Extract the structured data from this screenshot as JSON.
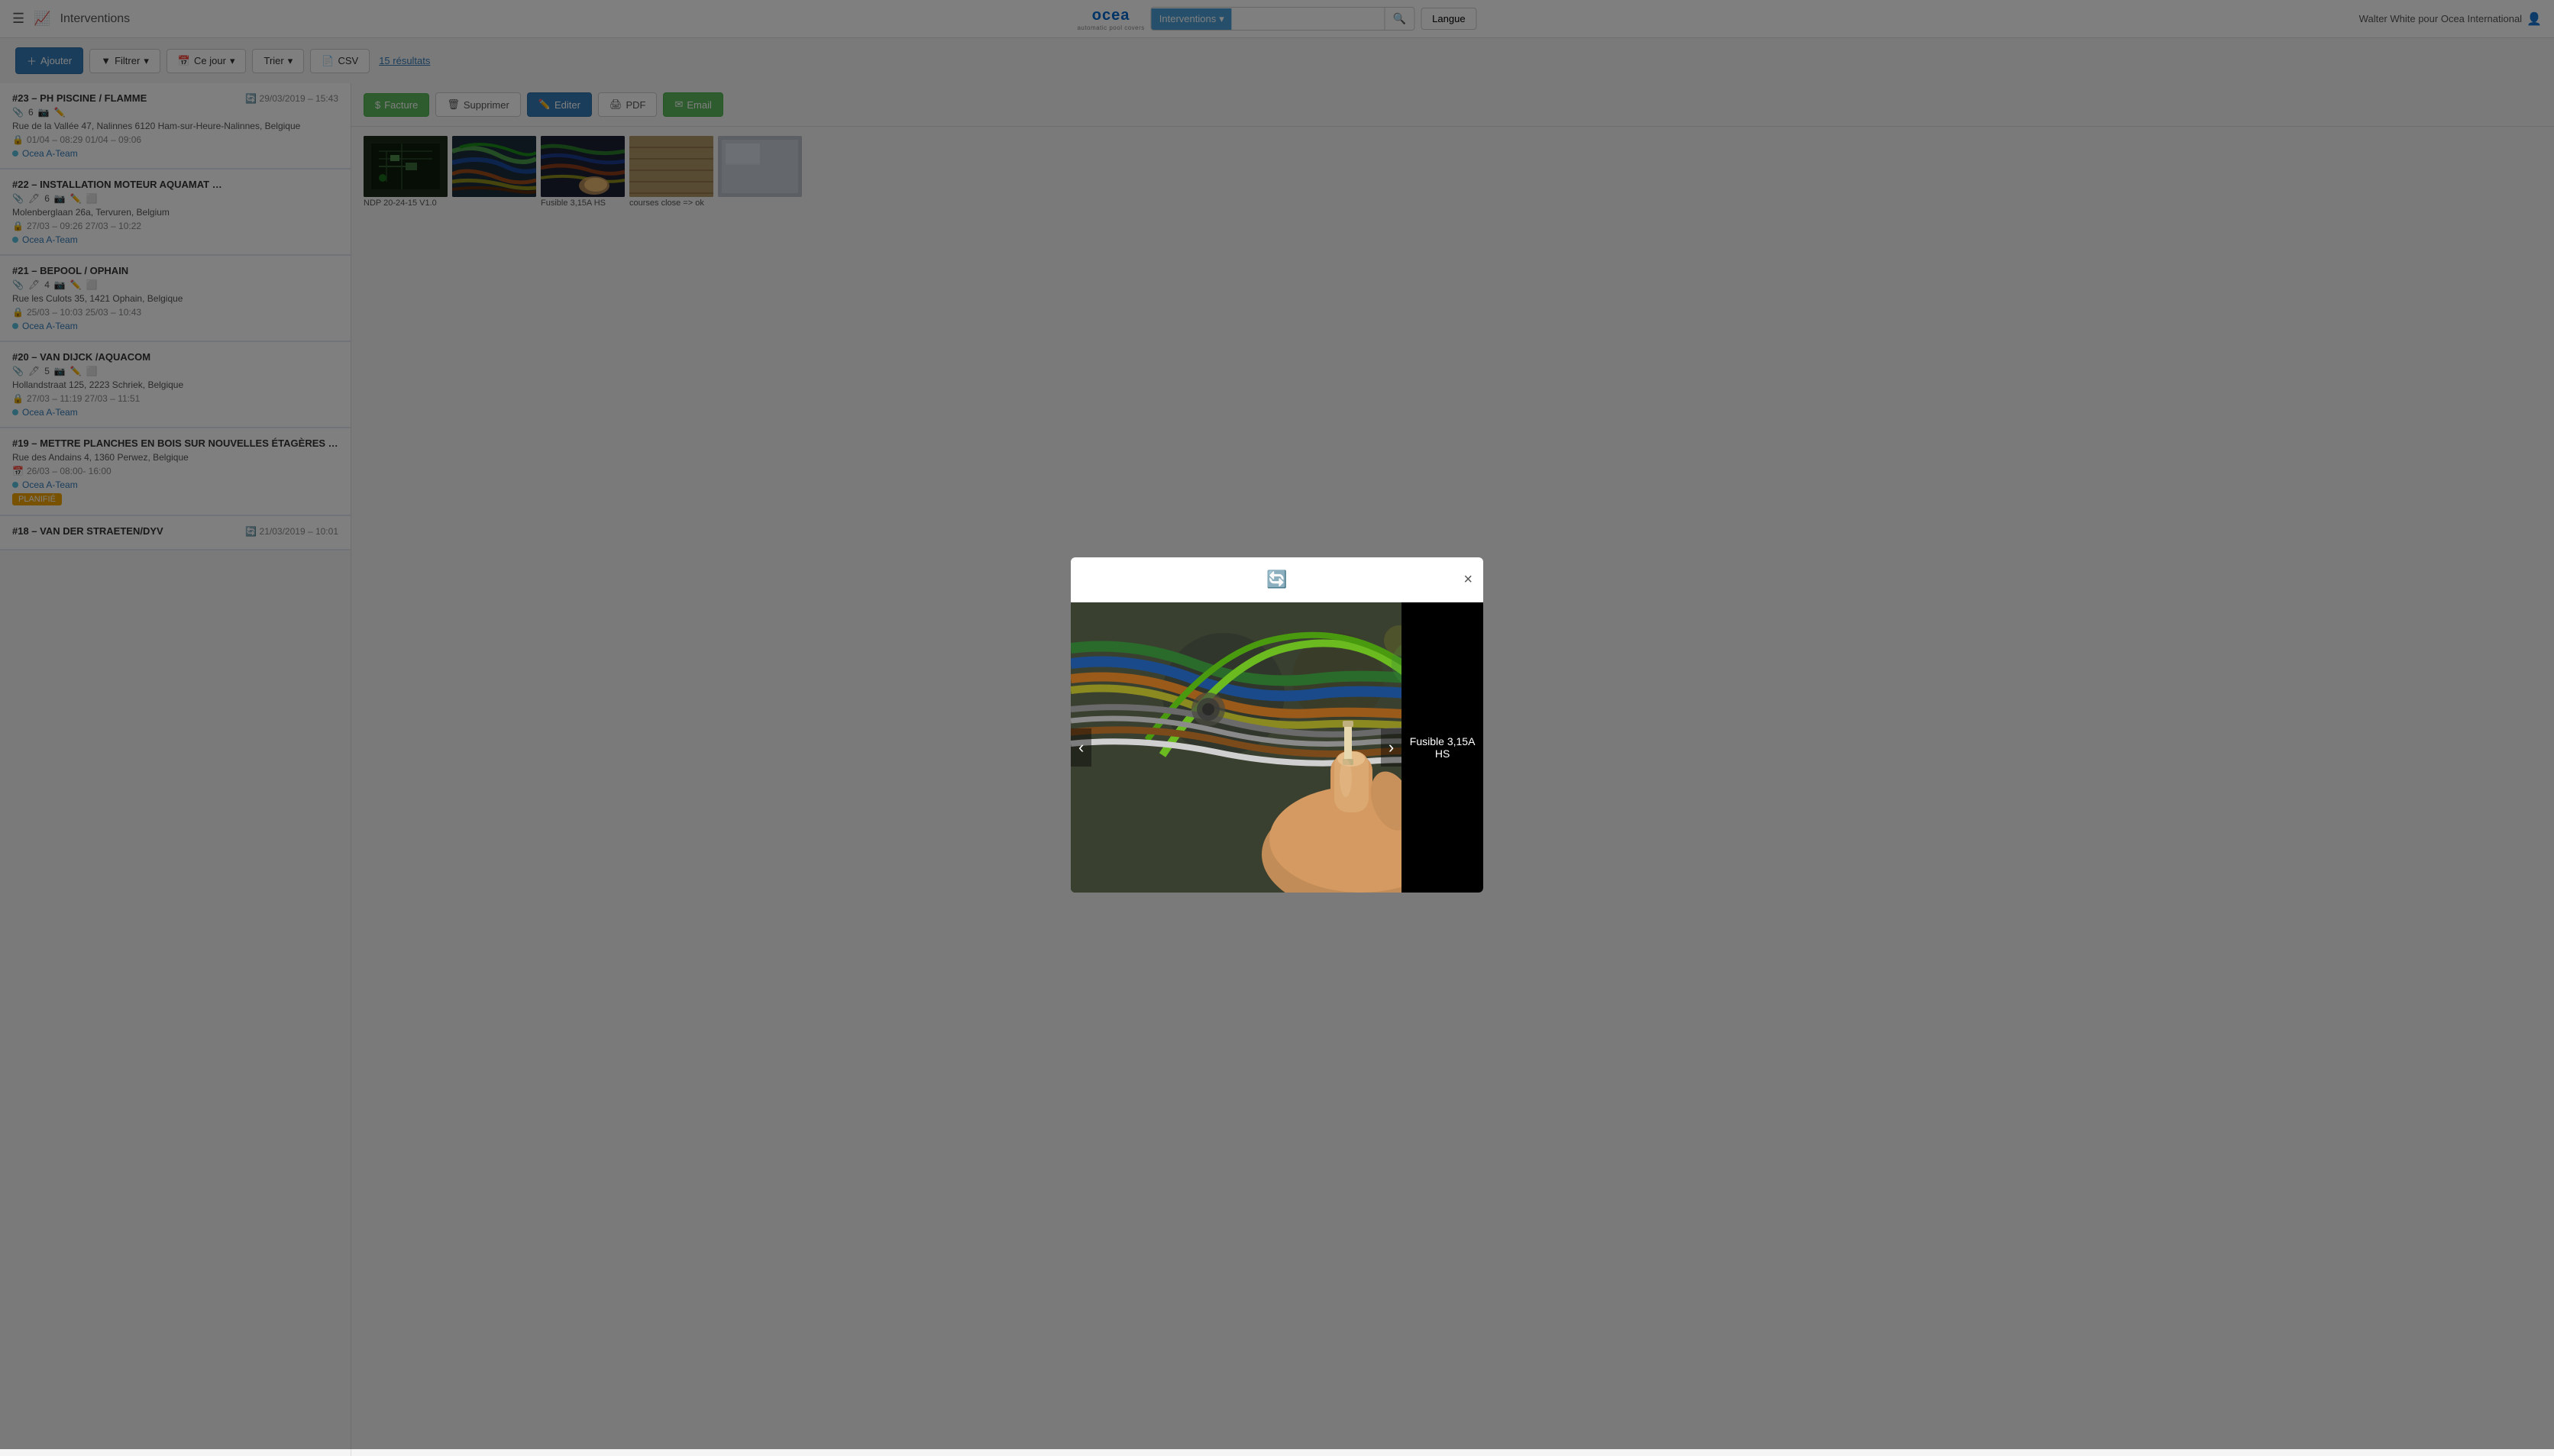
{
  "topnav": {
    "title": "Interventions",
    "logo": {
      "text": "ocea",
      "sub": "automatic pool covers"
    },
    "search": {
      "dropdown_label": "Interventions",
      "placeholder": ""
    },
    "langue_label": "Langue",
    "user": "Walter White pour Ocea International"
  },
  "toolbar": {
    "add_label": "Ajouter",
    "filter_label": "Filtrer",
    "day_label": "Ce jour",
    "sort_label": "Trier",
    "csv_label": "CSV",
    "results": "15 résultats"
  },
  "interventions": [
    {
      "id": "#23",
      "title": "#23 – PH PISCINE / FLAMME",
      "date": "29/03/2019 – 15:43",
      "icons_count": "6",
      "address": "Rue de la Vallée 47, Nalinnes 6120 Ham-sur-Heure-Nalinnes, Belgique",
      "time": "01/04 – 08:29 01/04 – 09:06",
      "team": "Ocea A-Team"
    },
    {
      "id": "#22",
      "title": "#22 – INSTALLATION MOTEUR AQUAMAT …",
      "date": "",
      "icons_count": "6",
      "address": "Molenberglaan 26a, Tervuren, Belgium",
      "time": "27/03 – 09:26 27/03 – 10:22",
      "team": "Ocea A-Team"
    },
    {
      "id": "#21",
      "title": "#21 – BEPOOL / OPHAIN",
      "date": "",
      "icons_count": "4",
      "address": "Rue les Culots 35, 1421 Ophain, Belgique",
      "time": "25/03 – 10:03 25/03 – 10:43",
      "team": "Ocea A-Team"
    },
    {
      "id": "#20",
      "title": "#20 – VAN DIJCK /AQUACOM",
      "date": "",
      "icons_count": "5",
      "address": "Hollandstraat 125, 2223 Schriek, Belgique",
      "time": "27/03 – 11:19 27/03 – 11:51",
      "team": "Ocea A-Team"
    },
    {
      "id": "#19",
      "title": "#19 – METTRE PLANCHES EN BOIS SUR NOUVELLES ÉTAGÈRES …",
      "date": "",
      "icons_count": "",
      "address": "Rue des Andains 4, 1360 Perwez, Belgique",
      "time": "26/03 – 08:00- 16:00",
      "team": "Ocea A-Team",
      "badge": "PLANIFIÉ"
    },
    {
      "id": "#18",
      "title": "#18 – VAN DER STRAETEN/DYV",
      "date": "21/03/2019 – 10:01",
      "icons_count": "",
      "address": "",
      "time": "",
      "team": ""
    }
  ],
  "right_panel": {
    "action_buttons": [
      {
        "label": "Facture",
        "type": "facture"
      },
      {
        "label": "Supprimer",
        "type": "supprimer"
      },
      {
        "label": "Editer",
        "type": "editer"
      },
      {
        "label": "PDF",
        "type": "pdf"
      },
      {
        "label": "Email",
        "type": "email"
      }
    ],
    "thumbnails": [
      {
        "id": "t1",
        "caption": "NDP 20-24-15 V1.0",
        "color": "circuit"
      },
      {
        "id": "t2",
        "caption": "",
        "color": "wires"
      },
      {
        "id": "t3",
        "caption": "Fusible 3,15A HS",
        "color": "wires"
      },
      {
        "id": "t4",
        "caption": "courses close => ok",
        "color": "wood"
      },
      {
        "id": "t5",
        "caption": "",
        "color": "door"
      }
    ]
  },
  "modal": {
    "visible": true,
    "caption": "Fusible 3,15A HS"
  }
}
